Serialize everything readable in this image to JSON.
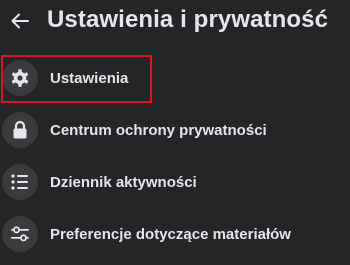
{
  "header": {
    "back_icon": "arrow-left-icon",
    "title": "Ustawienia i prywatność"
  },
  "menu": {
    "items": [
      {
        "label": "Ustawienia",
        "icon": "gear-icon"
      },
      {
        "label": "Centrum ochrony prywatności",
        "icon": "lock-icon"
      },
      {
        "label": "Dziennik aktywności",
        "icon": "list-icon"
      },
      {
        "label": "Preferencje dotyczące materiałów",
        "icon": "sliders-icon"
      }
    ]
  },
  "colors": {
    "background": "#242526",
    "icon_circle": "#3a3b3c",
    "text": "#e4e6eb",
    "highlight": "#e0141e"
  }
}
